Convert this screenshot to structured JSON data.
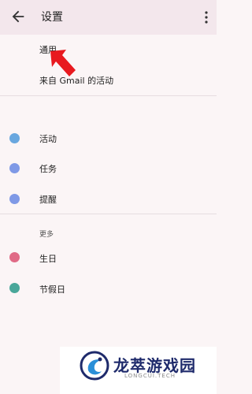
{
  "appbar": {
    "title": "设置",
    "back_icon": "arrow-back-icon",
    "menu_icon": "more-vert-icon"
  },
  "general": {
    "items": [
      {
        "label": "通用"
      },
      {
        "label": "来自 Gmail 的活动"
      }
    ]
  },
  "calendars": {
    "items": [
      {
        "label": "活动",
        "color": "#69a7df"
      },
      {
        "label": "任务",
        "color": "#7f99e6"
      },
      {
        "label": "提醒",
        "color": "#7f99e6"
      }
    ]
  },
  "more": {
    "header": "更多",
    "items": [
      {
        "label": "生日",
        "color": "#e06a86"
      },
      {
        "label": "节假日",
        "color": "#4aa79a"
      }
    ]
  },
  "annotation": {
    "icon": "red-pointer-arrow-icon",
    "color": "#e8191f"
  },
  "watermark": {
    "title": "龙萃游戏园",
    "subtitle": "LONGCUI.TECH"
  }
}
